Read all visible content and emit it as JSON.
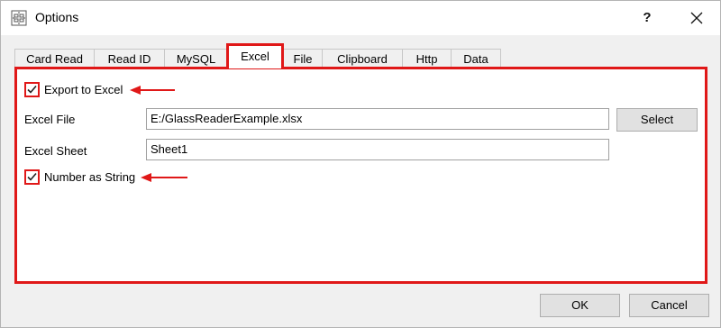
{
  "window": {
    "title": "Options",
    "help_label": "?"
  },
  "tabs": [
    {
      "label": "Card Read"
    },
    {
      "label": "Read ID"
    },
    {
      "label": "MySQL"
    },
    {
      "label": "Excel"
    },
    {
      "label": "File"
    },
    {
      "label": "Clipboard"
    },
    {
      "label": "Http"
    },
    {
      "label": "Data"
    }
  ],
  "active_tab": "Excel",
  "excel": {
    "export_checkbox": {
      "label": "Export to Excel",
      "checked": true
    },
    "file_label": "Excel File",
    "file_value": "E:/GlassReaderExample.xlsx",
    "select_label": "Select",
    "sheet_label": "Excel Sheet",
    "sheet_value": "Sheet1",
    "number_checkbox": {
      "label": "Number as String",
      "checked": true
    }
  },
  "footer": {
    "ok_label": "OK",
    "cancel_label": "Cancel"
  },
  "colors": {
    "highlight": "#e01818",
    "window_bg": "#f0f0f0"
  }
}
